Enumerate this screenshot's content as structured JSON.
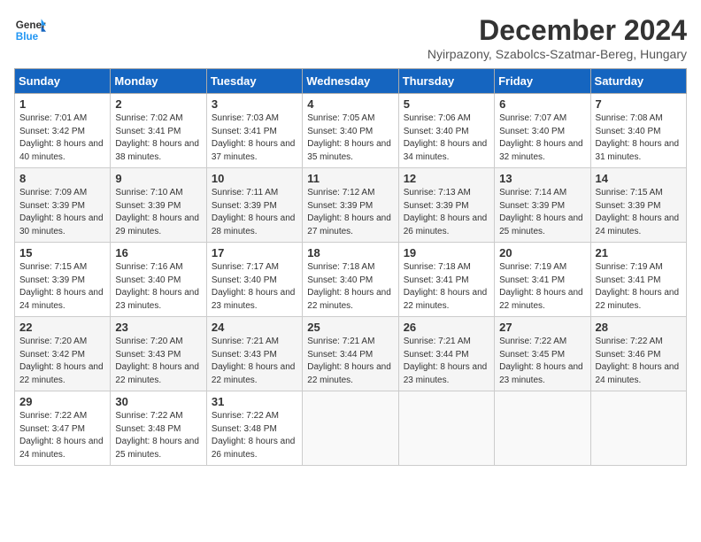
{
  "header": {
    "logo_line1": "General",
    "logo_line2": "Blue",
    "month": "December 2024",
    "location": "Nyirpazony, Szabolcs-Szatmar-Bereg, Hungary"
  },
  "weekdays": [
    "Sunday",
    "Monday",
    "Tuesday",
    "Wednesday",
    "Thursday",
    "Friday",
    "Saturday"
  ],
  "weeks": [
    [
      {
        "day": "1",
        "sunrise": "Sunrise: 7:01 AM",
        "sunset": "Sunset: 3:42 PM",
        "daylight": "Daylight: 8 hours and 40 minutes."
      },
      {
        "day": "2",
        "sunrise": "Sunrise: 7:02 AM",
        "sunset": "Sunset: 3:41 PM",
        "daylight": "Daylight: 8 hours and 38 minutes."
      },
      {
        "day": "3",
        "sunrise": "Sunrise: 7:03 AM",
        "sunset": "Sunset: 3:41 PM",
        "daylight": "Daylight: 8 hours and 37 minutes."
      },
      {
        "day": "4",
        "sunrise": "Sunrise: 7:05 AM",
        "sunset": "Sunset: 3:40 PM",
        "daylight": "Daylight: 8 hours and 35 minutes."
      },
      {
        "day": "5",
        "sunrise": "Sunrise: 7:06 AM",
        "sunset": "Sunset: 3:40 PM",
        "daylight": "Daylight: 8 hours and 34 minutes."
      },
      {
        "day": "6",
        "sunrise": "Sunrise: 7:07 AM",
        "sunset": "Sunset: 3:40 PM",
        "daylight": "Daylight: 8 hours and 32 minutes."
      },
      {
        "day": "7",
        "sunrise": "Sunrise: 7:08 AM",
        "sunset": "Sunset: 3:40 PM",
        "daylight": "Daylight: 8 hours and 31 minutes."
      }
    ],
    [
      {
        "day": "8",
        "sunrise": "Sunrise: 7:09 AM",
        "sunset": "Sunset: 3:39 PM",
        "daylight": "Daylight: 8 hours and 30 minutes."
      },
      {
        "day": "9",
        "sunrise": "Sunrise: 7:10 AM",
        "sunset": "Sunset: 3:39 PM",
        "daylight": "Daylight: 8 hours and 29 minutes."
      },
      {
        "day": "10",
        "sunrise": "Sunrise: 7:11 AM",
        "sunset": "Sunset: 3:39 PM",
        "daylight": "Daylight: 8 hours and 28 minutes."
      },
      {
        "day": "11",
        "sunrise": "Sunrise: 7:12 AM",
        "sunset": "Sunset: 3:39 PM",
        "daylight": "Daylight: 8 hours and 27 minutes."
      },
      {
        "day": "12",
        "sunrise": "Sunrise: 7:13 AM",
        "sunset": "Sunset: 3:39 PM",
        "daylight": "Daylight: 8 hours and 26 minutes."
      },
      {
        "day": "13",
        "sunrise": "Sunrise: 7:14 AM",
        "sunset": "Sunset: 3:39 PM",
        "daylight": "Daylight: 8 hours and 25 minutes."
      },
      {
        "day": "14",
        "sunrise": "Sunrise: 7:15 AM",
        "sunset": "Sunset: 3:39 PM",
        "daylight": "Daylight: 8 hours and 24 minutes."
      }
    ],
    [
      {
        "day": "15",
        "sunrise": "Sunrise: 7:15 AM",
        "sunset": "Sunset: 3:39 PM",
        "daylight": "Daylight: 8 hours and 24 minutes."
      },
      {
        "day": "16",
        "sunrise": "Sunrise: 7:16 AM",
        "sunset": "Sunset: 3:40 PM",
        "daylight": "Daylight: 8 hours and 23 minutes."
      },
      {
        "day": "17",
        "sunrise": "Sunrise: 7:17 AM",
        "sunset": "Sunset: 3:40 PM",
        "daylight": "Daylight: 8 hours and 23 minutes."
      },
      {
        "day": "18",
        "sunrise": "Sunrise: 7:18 AM",
        "sunset": "Sunset: 3:40 PM",
        "daylight": "Daylight: 8 hours and 22 minutes."
      },
      {
        "day": "19",
        "sunrise": "Sunrise: 7:18 AM",
        "sunset": "Sunset: 3:41 PM",
        "daylight": "Daylight: 8 hours and 22 minutes."
      },
      {
        "day": "20",
        "sunrise": "Sunrise: 7:19 AM",
        "sunset": "Sunset: 3:41 PM",
        "daylight": "Daylight: 8 hours and 22 minutes."
      },
      {
        "day": "21",
        "sunrise": "Sunrise: 7:19 AM",
        "sunset": "Sunset: 3:41 PM",
        "daylight": "Daylight: 8 hours and 22 minutes."
      }
    ],
    [
      {
        "day": "22",
        "sunrise": "Sunrise: 7:20 AM",
        "sunset": "Sunset: 3:42 PM",
        "daylight": "Daylight: 8 hours and 22 minutes."
      },
      {
        "day": "23",
        "sunrise": "Sunrise: 7:20 AM",
        "sunset": "Sunset: 3:43 PM",
        "daylight": "Daylight: 8 hours and 22 minutes."
      },
      {
        "day": "24",
        "sunrise": "Sunrise: 7:21 AM",
        "sunset": "Sunset: 3:43 PM",
        "daylight": "Daylight: 8 hours and 22 minutes."
      },
      {
        "day": "25",
        "sunrise": "Sunrise: 7:21 AM",
        "sunset": "Sunset: 3:44 PM",
        "daylight": "Daylight: 8 hours and 22 minutes."
      },
      {
        "day": "26",
        "sunrise": "Sunrise: 7:21 AM",
        "sunset": "Sunset: 3:44 PM",
        "daylight": "Daylight: 8 hours and 23 minutes."
      },
      {
        "day": "27",
        "sunrise": "Sunrise: 7:22 AM",
        "sunset": "Sunset: 3:45 PM",
        "daylight": "Daylight: 8 hours and 23 minutes."
      },
      {
        "day": "28",
        "sunrise": "Sunrise: 7:22 AM",
        "sunset": "Sunset: 3:46 PM",
        "daylight": "Daylight: 8 hours and 24 minutes."
      }
    ],
    [
      {
        "day": "29",
        "sunrise": "Sunrise: 7:22 AM",
        "sunset": "Sunset: 3:47 PM",
        "daylight": "Daylight: 8 hours and 24 minutes."
      },
      {
        "day": "30",
        "sunrise": "Sunrise: 7:22 AM",
        "sunset": "Sunset: 3:48 PM",
        "daylight": "Daylight: 8 hours and 25 minutes."
      },
      {
        "day": "31",
        "sunrise": "Sunrise: 7:22 AM",
        "sunset": "Sunset: 3:48 PM",
        "daylight": "Daylight: 8 hours and 26 minutes."
      },
      null,
      null,
      null,
      null
    ]
  ]
}
